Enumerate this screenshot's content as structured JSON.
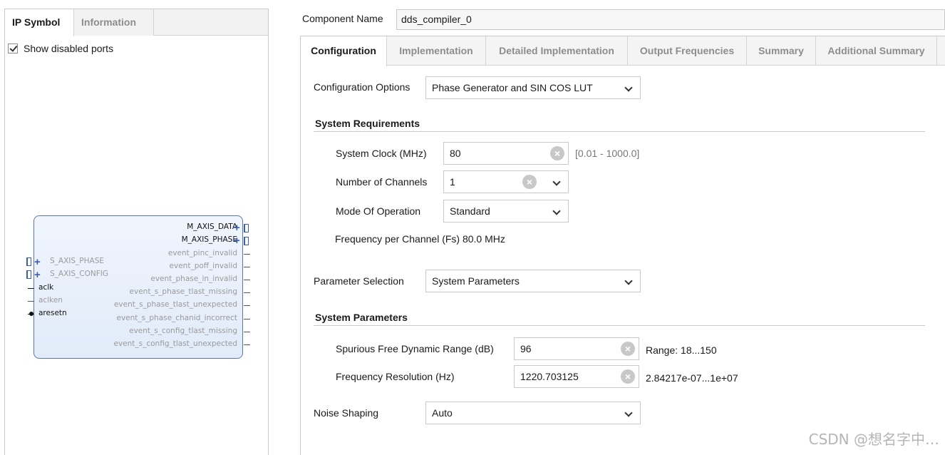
{
  "left_panel": {
    "tabs": [
      "IP Symbol",
      "Information"
    ],
    "show_disabled_ports": {
      "label": "Show disabled ports",
      "checked": true
    },
    "ip_block": {
      "right_ports": [
        {
          "name": "M_AXIS_DATA",
          "enabled": true,
          "bus": true
        },
        {
          "name": "M_AXIS_PHASE",
          "enabled": true,
          "bus": true
        },
        {
          "name": "event_pinc_invalid",
          "enabled": false
        },
        {
          "name": "event_poff_invalid",
          "enabled": false
        },
        {
          "name": "event_phase_in_invalid",
          "enabled": false
        },
        {
          "name": "event_s_phase_tlast_missing",
          "enabled": false
        },
        {
          "name": "event_s_phase_tlast_unexpected",
          "enabled": false
        },
        {
          "name": "event_s_phase_chanid_incorrect",
          "enabled": false
        },
        {
          "name": "event_s_config_tlast_missing",
          "enabled": false
        },
        {
          "name": "event_s_config_tlast_unexpected",
          "enabled": false
        }
      ],
      "left_ports": [
        {
          "name": "S_AXIS_PHASE",
          "enabled": false,
          "bus": true
        },
        {
          "name": "S_AXIS_CONFIG",
          "enabled": false,
          "bus": true
        },
        {
          "name": "aclk",
          "enabled": true
        },
        {
          "name": "aclken",
          "enabled": false
        },
        {
          "name": "aresetn",
          "enabled": true,
          "inverted": true
        }
      ]
    }
  },
  "component": {
    "label": "Component Name",
    "value": "dds_compiler_0"
  },
  "tabs": [
    "Configuration",
    "Implementation",
    "Detailed Implementation",
    "Output Frequencies",
    "Summary",
    "Additional Summary"
  ],
  "config_options": {
    "label": "Configuration Options",
    "value": "Phase Generator and SIN COS LUT"
  },
  "system_requirements": {
    "title": "System Requirements",
    "system_clock": {
      "label": "System Clock (MHz)",
      "value": "80",
      "range": "[0.01 - 1000.0]"
    },
    "num_channels": {
      "label": "Number of Channels",
      "value": "1"
    },
    "mode": {
      "label": "Mode Of Operation",
      "value": "Standard"
    },
    "freq_per_channel": "Frequency per Channel (Fs) 80.0 MHz"
  },
  "parameter_selection": {
    "label": "Parameter Selection",
    "value": "System Parameters"
  },
  "system_parameters": {
    "title": "System Parameters",
    "sfdr": {
      "label": "Spurious Free Dynamic Range (dB)",
      "value": "96",
      "range": "Range: 18...150"
    },
    "freq_res": {
      "label": "Frequency Resolution (Hz)",
      "value": "1220.703125",
      "range": "2.84217e-07...1e+07"
    }
  },
  "noise_shaping": {
    "label": "Noise Shaping",
    "value": "Auto"
  },
  "watermark": "CSDN @想名字中…",
  "colors": {
    "block_border": "#5b78ad",
    "block_fill": "#e8effa",
    "bus_icon": "#3a5fae"
  }
}
